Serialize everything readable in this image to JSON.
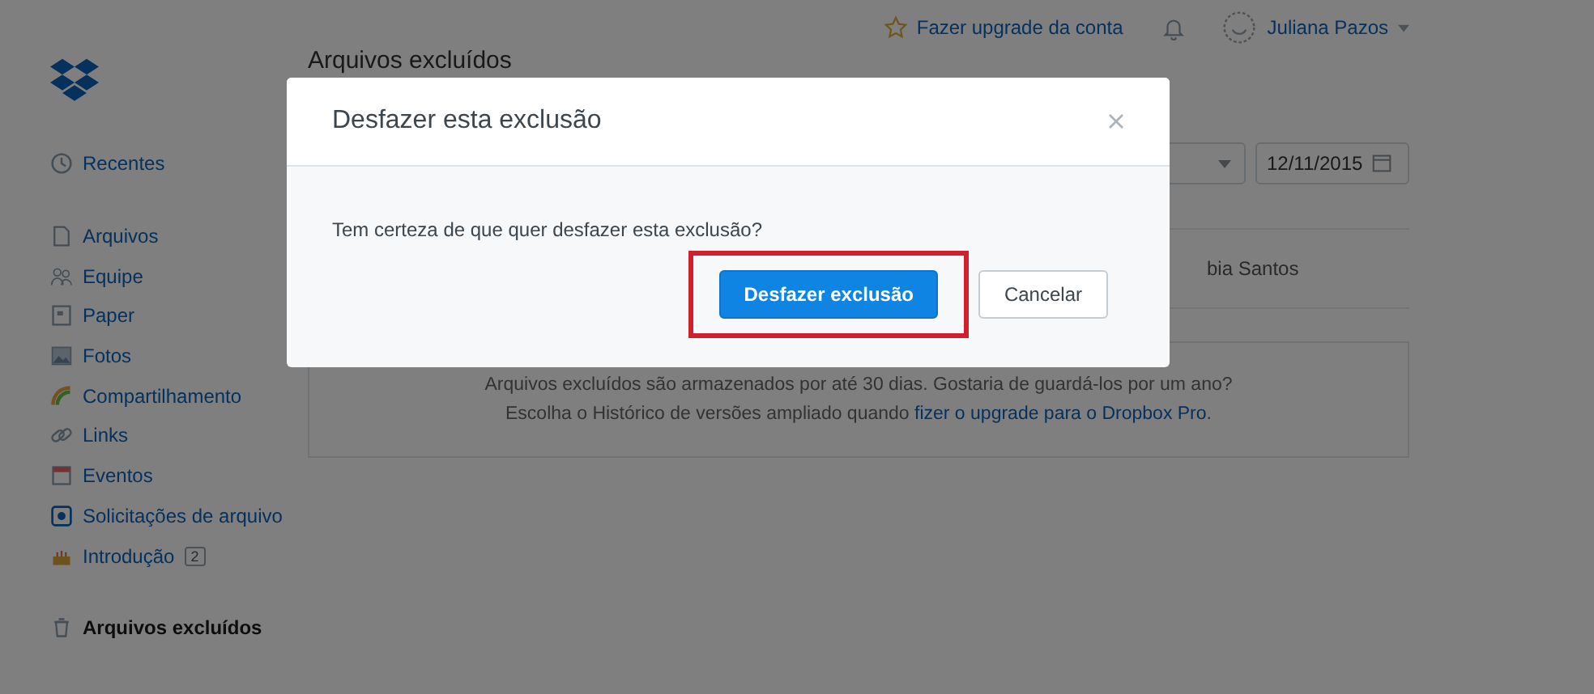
{
  "topbar": {
    "upgrade": "Fazer upgrade da conta",
    "user": "Juliana Pazos"
  },
  "sidebar": {
    "groups": [
      [
        {
          "label": "Recentes",
          "selected": false
        }
      ],
      [
        {
          "label": "Arquivos",
          "selected": false
        },
        {
          "label": "Equipe",
          "selected": false
        },
        {
          "label": "Paper",
          "selected": false
        },
        {
          "label": "Fotos",
          "selected": false
        },
        {
          "label": "Compartilhamento",
          "selected": false
        },
        {
          "label": "Links",
          "selected": false
        },
        {
          "label": "Eventos",
          "selected": false
        },
        {
          "label": "Solicitações de arquivo",
          "selected": false
        },
        {
          "label": "Introdução",
          "selected": false,
          "badge": "2"
        }
      ],
      [
        {
          "label": "Arquivos excluídos",
          "selected": true
        }
      ]
    ]
  },
  "main": {
    "title": "Arquivos excluídos",
    "date": "12/11/2015",
    "row_text": "bia Santos",
    "info": [
      "Arquivos excluídos são armazenados por até 30 dias. Gostaria de guardá-los por um ano?",
      "Escolha o Histórico de versões ampliado quando"
    ],
    "info_link": "fizer o upgrade para o Dropbox Pro",
    "info_end": "."
  },
  "dialog": {
    "title": "Desfazer esta exclusão",
    "message": "Tem certeza de que quer desfazer esta exclusão?",
    "buttons": [
      {
        "label": "Desfazer exclusão",
        "kind": "primary",
        "highlighted": true
      },
      {
        "label": "Cancelar",
        "kind": "secondary",
        "highlighted": false
      }
    ]
  }
}
